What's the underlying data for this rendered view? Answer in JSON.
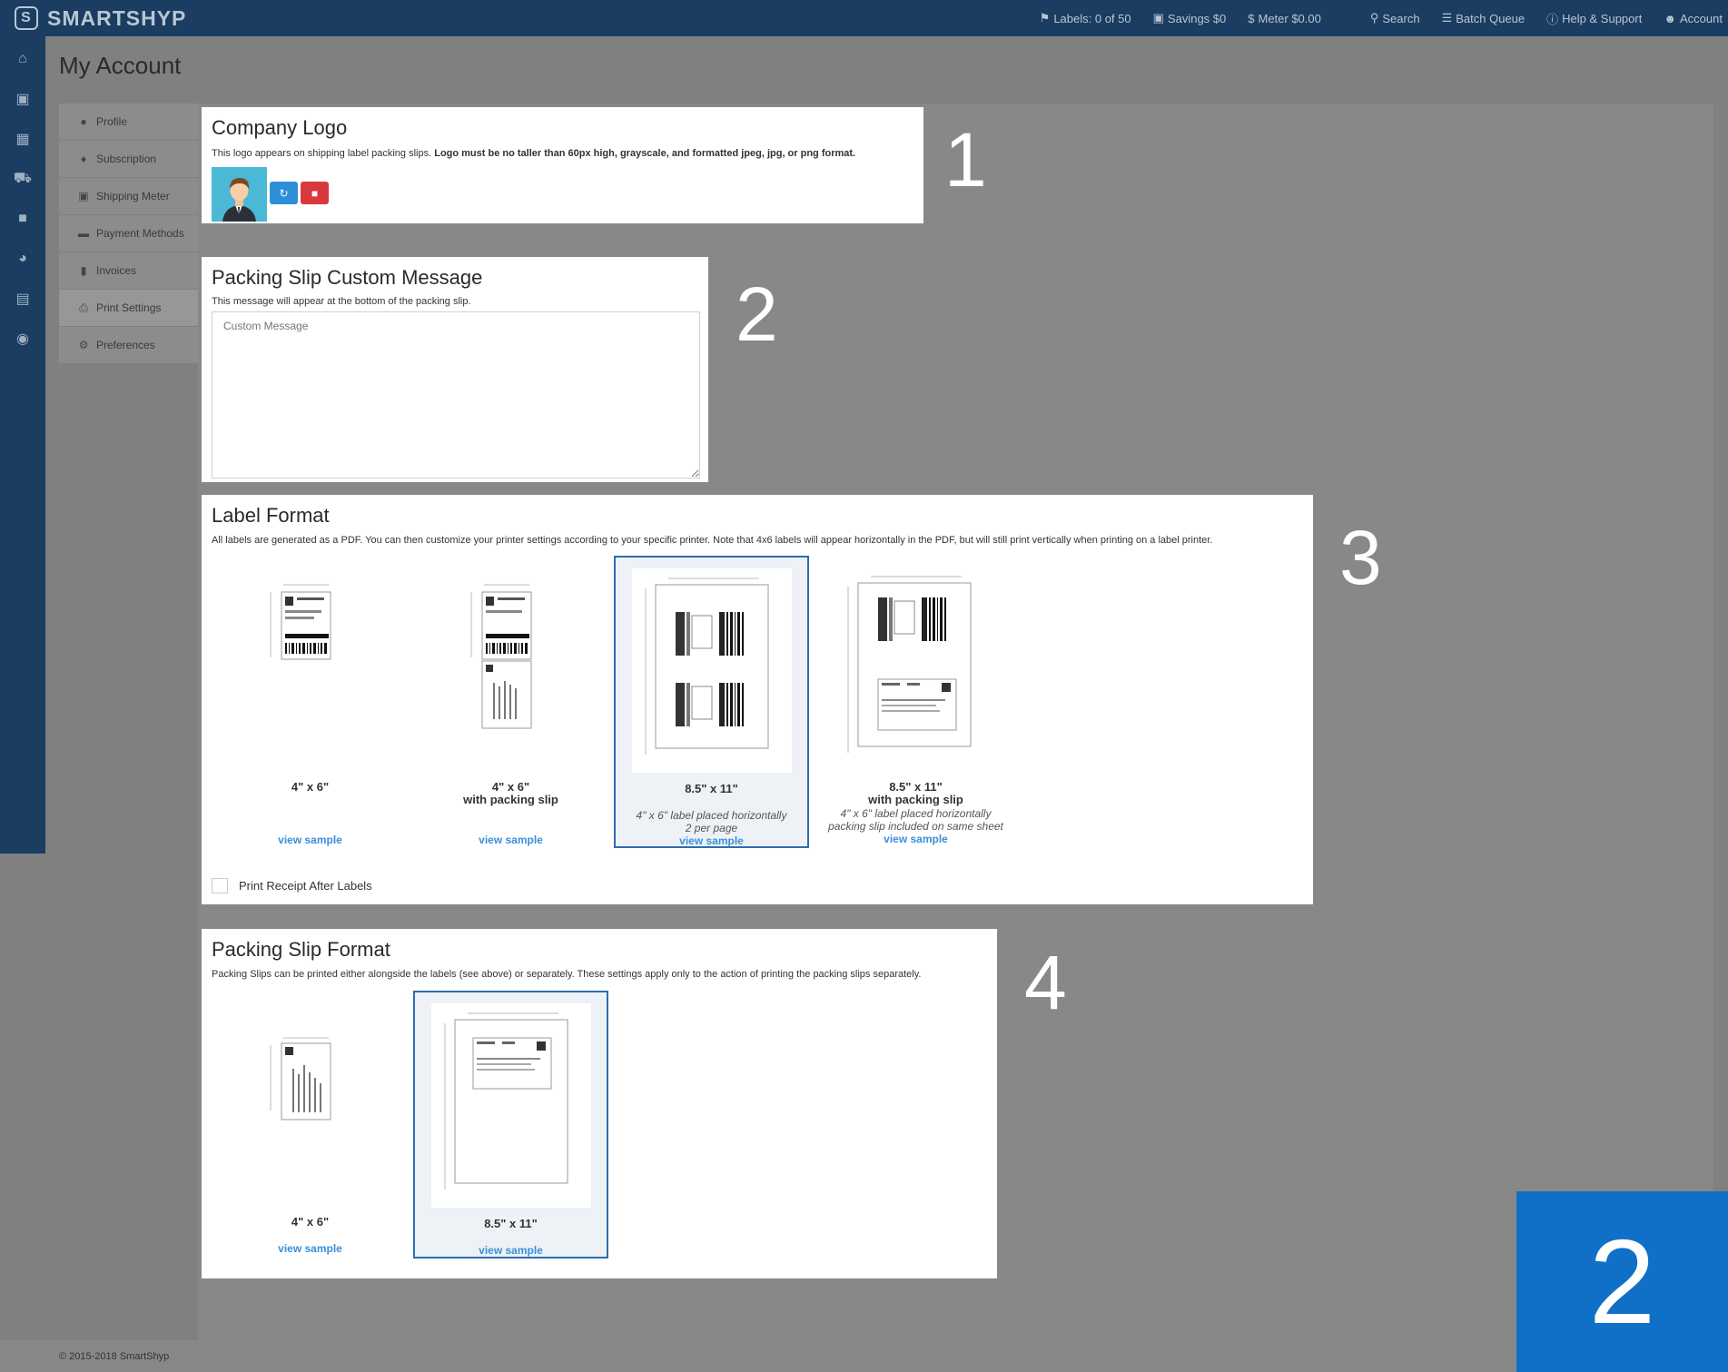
{
  "topbar": {
    "brand": "SMARTSHYP",
    "labels": "Labels: 0 of 50",
    "savings": "Savings $0",
    "meter": "Meter $0.00",
    "search": "Search",
    "batch_queue": "Batch Queue",
    "help": "Help & Support",
    "account": "Account"
  },
  "sidebar_icons": [
    "home-icon",
    "basket-icon",
    "calendar-icon",
    "truck-icon",
    "address-book-icon",
    "pie-chart-icon",
    "cart-icon",
    "lock-icon"
  ],
  "page_title": "My Account",
  "subnav": [
    {
      "label": "Profile",
      "icon": "user-icon"
    },
    {
      "label": "Subscription",
      "icon": "ticket-icon"
    },
    {
      "label": "Shipping Meter",
      "icon": "money-icon"
    },
    {
      "label": "Payment Methods",
      "icon": "credit-card-icon"
    },
    {
      "label": "Invoices",
      "icon": "file-icon"
    },
    {
      "label": "Print Settings",
      "icon": "print-icon",
      "active": true
    },
    {
      "label": "Preferences",
      "icon": "cogs-icon"
    }
  ],
  "company_logo": {
    "title": "Company Logo",
    "desc_plain": "This logo appears on shipping label packing slips. ",
    "desc_bold": "Logo must be no taller than 60px high, grayscale, and formatted jpeg, jpg, or png format."
  },
  "custom_message": {
    "title": "Packing Slip Custom Message",
    "desc": "This message will appear at the bottom of the packing slip.",
    "placeholder": "Custom Message"
  },
  "label_format": {
    "title": "Label Format",
    "desc": "All labels are generated as a PDF. You can then customize your printer settings according to your specific printer. Note that 4x6 labels will appear horizontally in the PDF, but will still print vertically when printing on a label printer.",
    "options": [
      {
        "title": "4\" x 6\"",
        "subtitle": "",
        "note1": "",
        "note2": "",
        "link": "view sample",
        "selected": false
      },
      {
        "title": "4\" x 6\"",
        "subtitle": "with packing slip",
        "note1": "",
        "note2": "",
        "link": "view sample",
        "selected": false
      },
      {
        "title": "8.5\" x 11\"",
        "subtitle": "",
        "note1": "4\" x 6\" label placed horizontally",
        "note2": "2 per page",
        "link": "view sample",
        "selected": true
      },
      {
        "title": "8.5\" x 11\"",
        "subtitle": "with packing slip",
        "note1": "4\" x 6\" label placed horizontally",
        "note2": "packing slip included on same sheet",
        "link": "view sample",
        "selected": false
      }
    ],
    "print_receipt_label": "Print Receipt After Labels",
    "print_receipt_checked": false
  },
  "packing_slip_format": {
    "title": "Packing Slip Format",
    "desc": "Packing Slips can be printed either alongside the labels (see above) or separately. These settings apply only to the action of printing the packing slips separately.",
    "options": [
      {
        "title": "4\" x 6\"",
        "link": "view sample",
        "selected": false
      },
      {
        "title": "8.5\" x 11\"",
        "link": "view sample",
        "selected": true
      }
    ]
  },
  "step_numbers": [
    "1",
    "2",
    "3",
    "4"
  ],
  "corner_badge": "2",
  "footer": "© 2015-2018 SmartShyp",
  "colors": {
    "topbar": "#1a3d61",
    "link": "#3a8fd9",
    "selected_border": "#2d6db0",
    "badge": "#1070c8"
  }
}
